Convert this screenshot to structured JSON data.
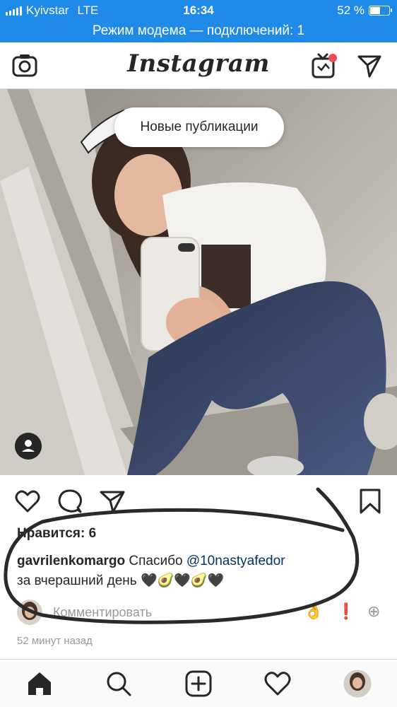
{
  "status_bar": {
    "carrier": "Kyivstar",
    "network": "LTE",
    "time": "16:34",
    "battery": "52 %",
    "battery_level": 0.52
  },
  "hotspot_banner": "Режим модема — подключений: 1",
  "header": {
    "brand": "Instagram",
    "left_icon": "camera-icon",
    "right_icons": [
      "igtv-icon",
      "direct-icon"
    ],
    "badge_color": "#ed4956"
  },
  "post": {
    "new_posts_pill": "Новые публикации",
    "likes": "Нравится: 6",
    "username": "gavrilenkomargo",
    "caption_text": " Спасибо ",
    "mention": "@10nastyafedor",
    "caption_line2": "за вчерашний день 🖤🥑🖤🥑🖤",
    "comment_placeholder": "Комментировать",
    "quick_reactions": [
      "👌",
      "❗",
      "⊕"
    ],
    "time_ago": "52 минут назад"
  },
  "tab_bar": {
    "items": [
      "home-icon",
      "search-icon",
      "new-post-icon",
      "activity-icon",
      "profile-avatar"
    ]
  },
  "colors": {
    "status_bar": "#1f8ae8",
    "mention": "#003569",
    "secondary_text": "#999999"
  }
}
